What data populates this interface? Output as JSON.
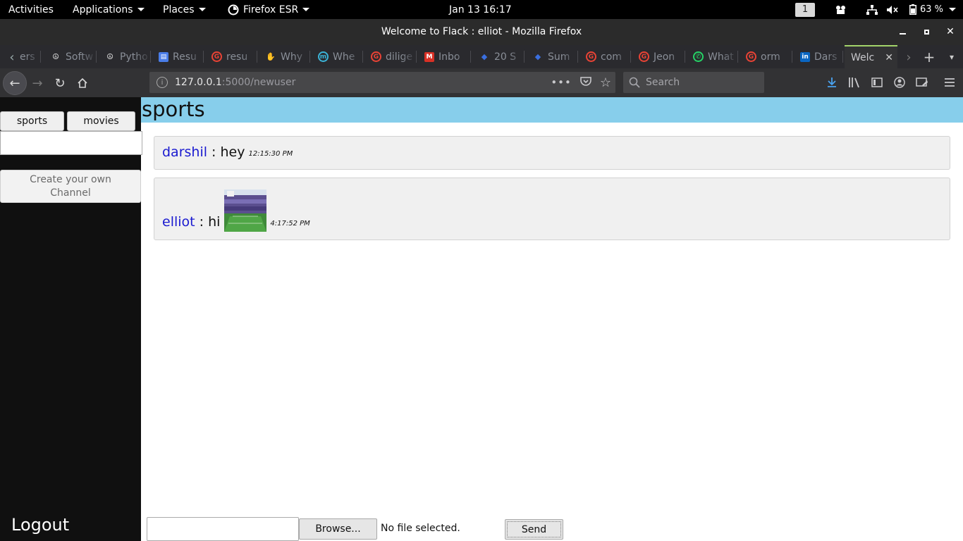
{
  "gnome": {
    "activities": "Activities",
    "applications": "Applications",
    "places": "Places",
    "firefox": "Firefox ESR",
    "clock": "Jan 13  16:17",
    "workspace": "1",
    "battery": "63 %"
  },
  "window": {
    "title": "Welcome to Flack : elliot - Mozilla Firefox"
  },
  "tabs": [
    {
      "label": "ers",
      "icon": "page-icon",
      "color": "#888888"
    },
    {
      "label": "Softw",
      "icon": "peace-icon",
      "color": "#dddddd"
    },
    {
      "label": "Pytho",
      "icon": "peace-icon",
      "color": "#dddddd"
    },
    {
      "label": "Resu",
      "icon": "docs-icon",
      "color": "#4a7de8"
    },
    {
      "label": "resu",
      "icon": "google-icon",
      "color": "#ea4335"
    },
    {
      "label": "Why",
      "icon": "hand-icon",
      "color": "#e6a23c"
    },
    {
      "label": "Whe",
      "icon": "m-icon",
      "color": "#3bb4d8"
    },
    {
      "label": "dilige",
      "icon": "google-icon",
      "color": "#ea4335"
    },
    {
      "label": "Inbo",
      "icon": "gmail-icon",
      "color": "#d93025"
    },
    {
      "label": "20 S",
      "icon": "cap-icon",
      "color": "#3a6fe0"
    },
    {
      "label": "Sum",
      "icon": "cap-icon",
      "color": "#3a6fe0"
    },
    {
      "label": "com",
      "icon": "google-icon",
      "color": "#ea4335"
    },
    {
      "label": "Jeon",
      "icon": "google-icon",
      "color": "#ea4335"
    },
    {
      "label": "What",
      "icon": "whatsapp-icon",
      "color": "#25d366"
    },
    {
      "label": "orm",
      "icon": "google-icon",
      "color": "#ea4335"
    },
    {
      "label": "Dars",
      "icon": "linkedin-icon",
      "color": "#0a66c2"
    },
    {
      "label": "Welc",
      "icon": "none",
      "color": "#888888"
    }
  ],
  "nav": {
    "url_host": "127.0.0.1",
    "url_path": ":5000/newuser",
    "search_placeholder": "Search"
  },
  "sidebar": {
    "channels": [
      "sports",
      "movies"
    ],
    "channel_input_value": "",
    "create_label": "Create your own Channel",
    "logout_label": "Logout"
  },
  "channel": {
    "name": "sports"
  },
  "messages": [
    {
      "user": "darshil",
      "sep": " : ",
      "text": "hey",
      "time": "12:15:30 PM",
      "has_image": false
    },
    {
      "user": "elliot",
      "sep": " : ",
      "text": "hi",
      "time": "4:17:52 PM",
      "has_image": true,
      "image": "stadium-photo"
    }
  ],
  "composer": {
    "input_value": "",
    "browse_label": "Browse...",
    "file_status": "No file selected.",
    "send_label": "Send"
  },
  "colors": {
    "channel_header_bg": "#87ceeb",
    "username": "#1a1ad0",
    "sidebar_bg": "#101010"
  }
}
